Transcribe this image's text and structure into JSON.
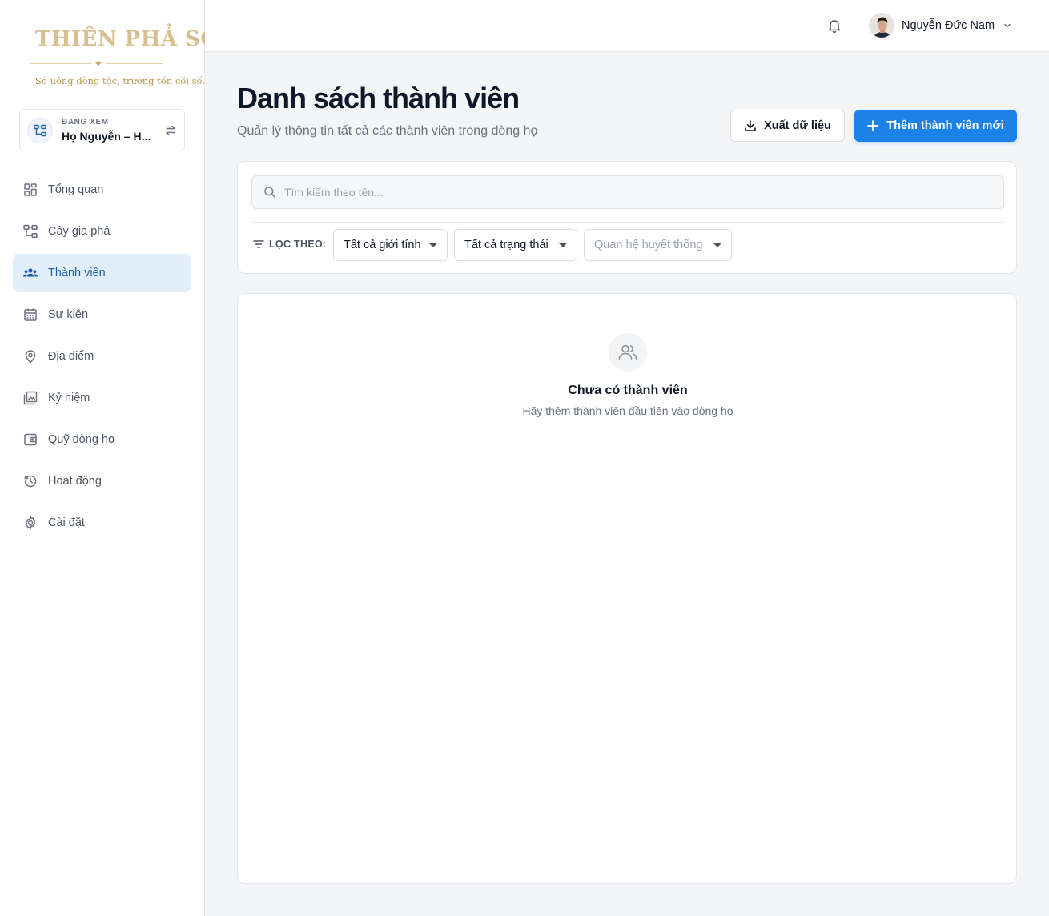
{
  "brand": {
    "title": "THIÊN PHẢ SỐ",
    "slogan": "Số uông dòng tộc, trường tồn cõi số."
  },
  "viewing": {
    "caption": "ĐANG XEM",
    "clan_name": "Họ Nguyễn – H..."
  },
  "sidebar": {
    "items": [
      {
        "label": "Tổng quan",
        "icon": "dashboard-icon"
      },
      {
        "label": "Cây gia phả",
        "icon": "family-tree-icon"
      },
      {
        "label": "Thành viên",
        "icon": "group-icon",
        "active": true
      },
      {
        "label": "Sự kiện",
        "icon": "calendar-icon"
      },
      {
        "label": "Địa điểm",
        "icon": "location-pin-icon"
      },
      {
        "label": "Kỷ niệm",
        "icon": "photo-library-icon"
      },
      {
        "label": "Quỹ dòng họ",
        "icon": "wallet-icon"
      },
      {
        "label": "Hoạt động",
        "icon": "history-icon"
      },
      {
        "label": "Cài đặt",
        "icon": "gear-icon"
      }
    ]
  },
  "header": {
    "user_name": "Nguyễn Đức Nam"
  },
  "page": {
    "title": "Danh sách thành viên",
    "subtitle": "Quản lý thông tin tất cả các thành viên trong dòng họ",
    "export_label": "Xuất dữ liệu",
    "add_label": "Thêm thành viên mới"
  },
  "filters": {
    "search_placeholder": "Tìm kiếm theo tên...",
    "label": "LỌC THEO:",
    "gender": "Tất cả giới tính",
    "status": "Tất cả trạng thái",
    "relation_placeholder": "Quan hệ huyết thống"
  },
  "empty": {
    "title": "Chưa có thành viên",
    "description": "Hãy thêm thành viên đầu tiên vào dòng họ"
  },
  "colors": {
    "accent": "#1a82e8",
    "active_nav_bg": "#e3eefb",
    "brand_gold": "#d8bf8f"
  }
}
